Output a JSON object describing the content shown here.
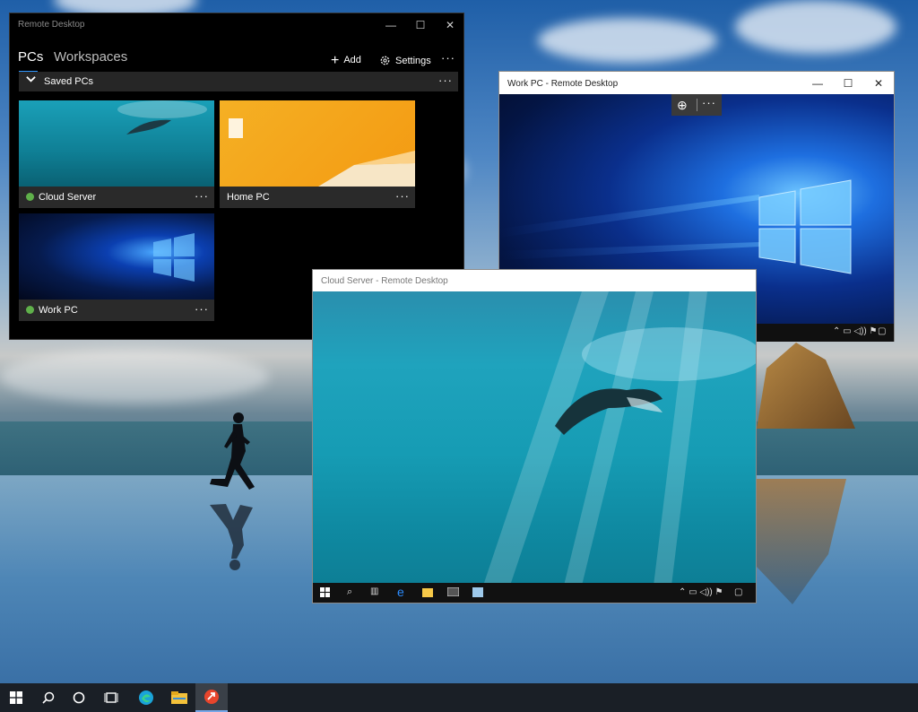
{
  "rd_app": {
    "title": "Remote Desktop",
    "tabs": [
      {
        "label": "PCs"
      },
      {
        "label": "Workspaces"
      }
    ],
    "toolbar": {
      "add_label": "Add",
      "settings_label": "Settings",
      "more_label": "···"
    },
    "group": {
      "label": "Saved PCs",
      "more": "···"
    },
    "pcs": [
      {
        "name": "Cloud Server",
        "status": "connected",
        "more": "···"
      },
      {
        "name": "Home PC",
        "status": "",
        "more": "···"
      },
      {
        "name": "Work PC",
        "status": "connected",
        "more": "···"
      }
    ],
    "window_controls": {
      "minimize": "—",
      "maximize": "☐",
      "close": "✕"
    }
  },
  "work_pc_window": {
    "title": "Work PC - Remote Desktop",
    "zoom_bar": {
      "zoom_icon": "⊕",
      "more": "···"
    },
    "window_controls": {
      "minimize": "—",
      "maximize": "☐",
      "close": "✕"
    }
  },
  "cloud_server_window": {
    "title": "Cloud Server - Remote Desktop"
  },
  "taskbar": {
    "icons": [
      "windows-icon",
      "search-icon",
      "cortana-icon",
      "task-view-icon",
      "edge-icon",
      "file-explorer-icon",
      "remote-desktop-icon"
    ]
  },
  "colors": {
    "accent": "#2f96ff",
    "status_green": "#5fb04a",
    "app_background": "#000000"
  }
}
